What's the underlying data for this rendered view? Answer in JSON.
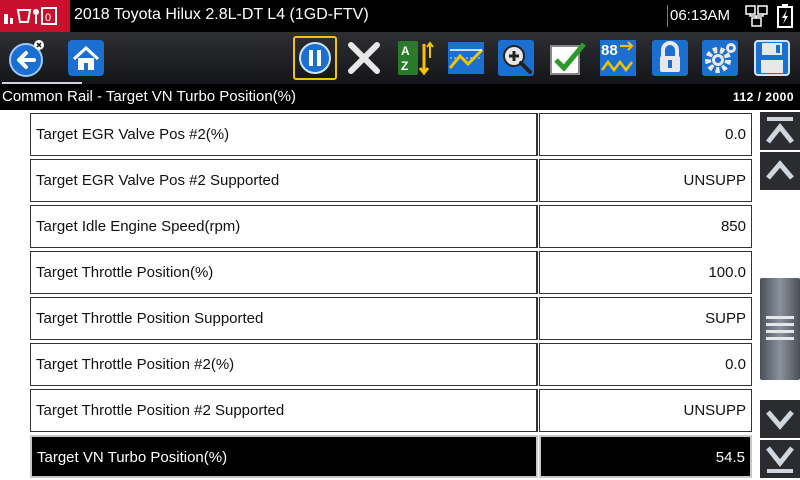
{
  "title_bar": {
    "vehicle": "2018 Toyota Hilux 2.8L-DT L4 (1GD-FTV)",
    "time": "06:13AM",
    "icons": [
      "app-logo-icon",
      "network-icon",
      "battery-icon"
    ]
  },
  "toolbar": {
    "buttons": [
      {
        "name": "back",
        "icon": "back-arrow-icon"
      },
      {
        "name": "home",
        "icon": "home-icon"
      },
      {
        "name": "pause",
        "icon": "pause-icon"
      },
      {
        "name": "clear",
        "icon": "x-icon"
      },
      {
        "name": "sort",
        "icon": "sort-icon"
      },
      {
        "name": "graph",
        "icon": "graph-icon"
      },
      {
        "name": "zoom",
        "icon": "zoom-icon"
      },
      {
        "name": "select",
        "icon": "checkmark-icon"
      },
      {
        "name": "units",
        "icon": "units-icon"
      },
      {
        "name": "lock",
        "icon": "lock-icon"
      },
      {
        "name": "settings",
        "icon": "gear-icon"
      },
      {
        "name": "save",
        "icon": "save-icon"
      }
    ],
    "units_button_text": "88",
    "accent_color": "#f5c400"
  },
  "status": {
    "title": "Common Rail - Target VN Turbo Position(%)",
    "counter": "112 / 2000"
  },
  "rows": [
    {
      "name": "Target EGR Valve Pos #2(%)",
      "value": "0.0"
    },
    {
      "name": "Target EGR Valve Pos #2 Supported",
      "value": "UNSUPP"
    },
    {
      "name": "Target Idle Engine Speed(rpm)",
      "value": "850"
    },
    {
      "name": "Target Throttle Position(%)",
      "value": "100.0"
    },
    {
      "name": "Target Throttle Position Supported",
      "value": "SUPP"
    },
    {
      "name": "Target Throttle Position #2(%)",
      "value": "0.0"
    },
    {
      "name": "Target Throttle Position #2 Supported",
      "value": "UNSUPP"
    },
    {
      "name": "Target VN Turbo Position(%)",
      "value": "54.5",
      "selected": true
    }
  ],
  "colors": {
    "brand_red": "#c8102e",
    "toolbar_blue": "#1a6fd1",
    "selected_row_bg": "#000000"
  }
}
